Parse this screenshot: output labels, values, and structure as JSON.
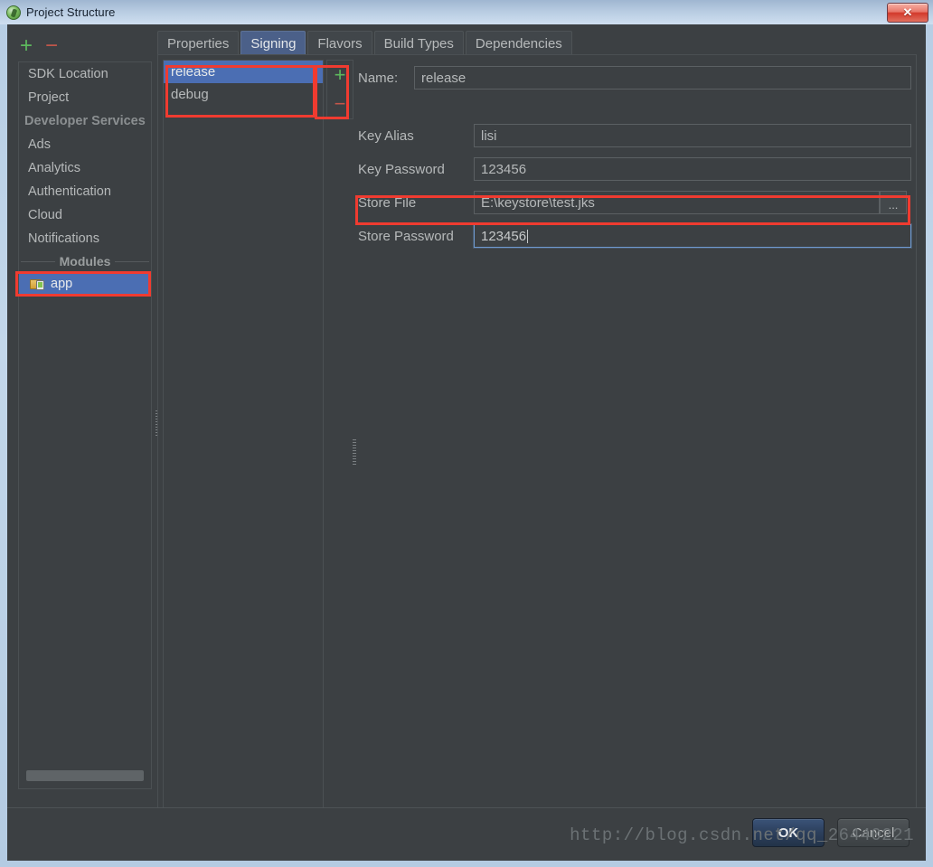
{
  "window": {
    "title": "Project Structure",
    "app_icon": "android-studio-icon",
    "close_label": "✕"
  },
  "sidebar": {
    "toolbar": {
      "add_label": "+",
      "remove_label": "−"
    },
    "items": [
      {
        "label": "SDK Location",
        "type": "item"
      },
      {
        "label": "Project",
        "type": "item"
      },
      {
        "label": "Developer Services",
        "type": "group"
      },
      {
        "label": "Ads",
        "type": "item"
      },
      {
        "label": "Analytics",
        "type": "item"
      },
      {
        "label": "Authentication",
        "type": "item"
      },
      {
        "label": "Cloud",
        "type": "item"
      },
      {
        "label": "Notifications",
        "type": "item"
      }
    ],
    "separator_label": "Modules",
    "module": {
      "label": "app",
      "icon": "android-module-icon",
      "selected": true
    }
  },
  "tabs": [
    {
      "label": "Properties",
      "active": false
    },
    {
      "label": "Signing",
      "active": true
    },
    {
      "label": "Flavors",
      "active": false
    },
    {
      "label": "Build Types",
      "active": false
    },
    {
      "label": "Dependencies",
      "active": false
    }
  ],
  "variants": {
    "items": [
      {
        "label": "release",
        "selected": true
      },
      {
        "label": "debug",
        "selected": false
      }
    ],
    "toolbar": {
      "add_label": "+",
      "remove_label": "−"
    }
  },
  "form": {
    "name": {
      "label": "Name:",
      "value": "release"
    },
    "key_alias": {
      "label": "Key Alias",
      "value": "lisi"
    },
    "key_password": {
      "label": "Key Password",
      "value": "123456"
    },
    "store_file": {
      "label": "Store File",
      "value": "E:\\keystore\\test.jks",
      "browse_label": "..."
    },
    "store_password": {
      "label": "Store Password",
      "value": "123456",
      "focused": true
    }
  },
  "buttons": {
    "ok": "OK",
    "cancel": "Cancel"
  },
  "watermark": "http://blog.csdn.net/qq_26440221",
  "colors": {
    "background": "#3c4043",
    "selection": "#4b6eb3",
    "tab_active": "#4b6089",
    "annotation": "#f03b30",
    "add_green": "#5db85d",
    "remove_red": "#c4564a",
    "focus_border": "#6f9ad1"
  }
}
